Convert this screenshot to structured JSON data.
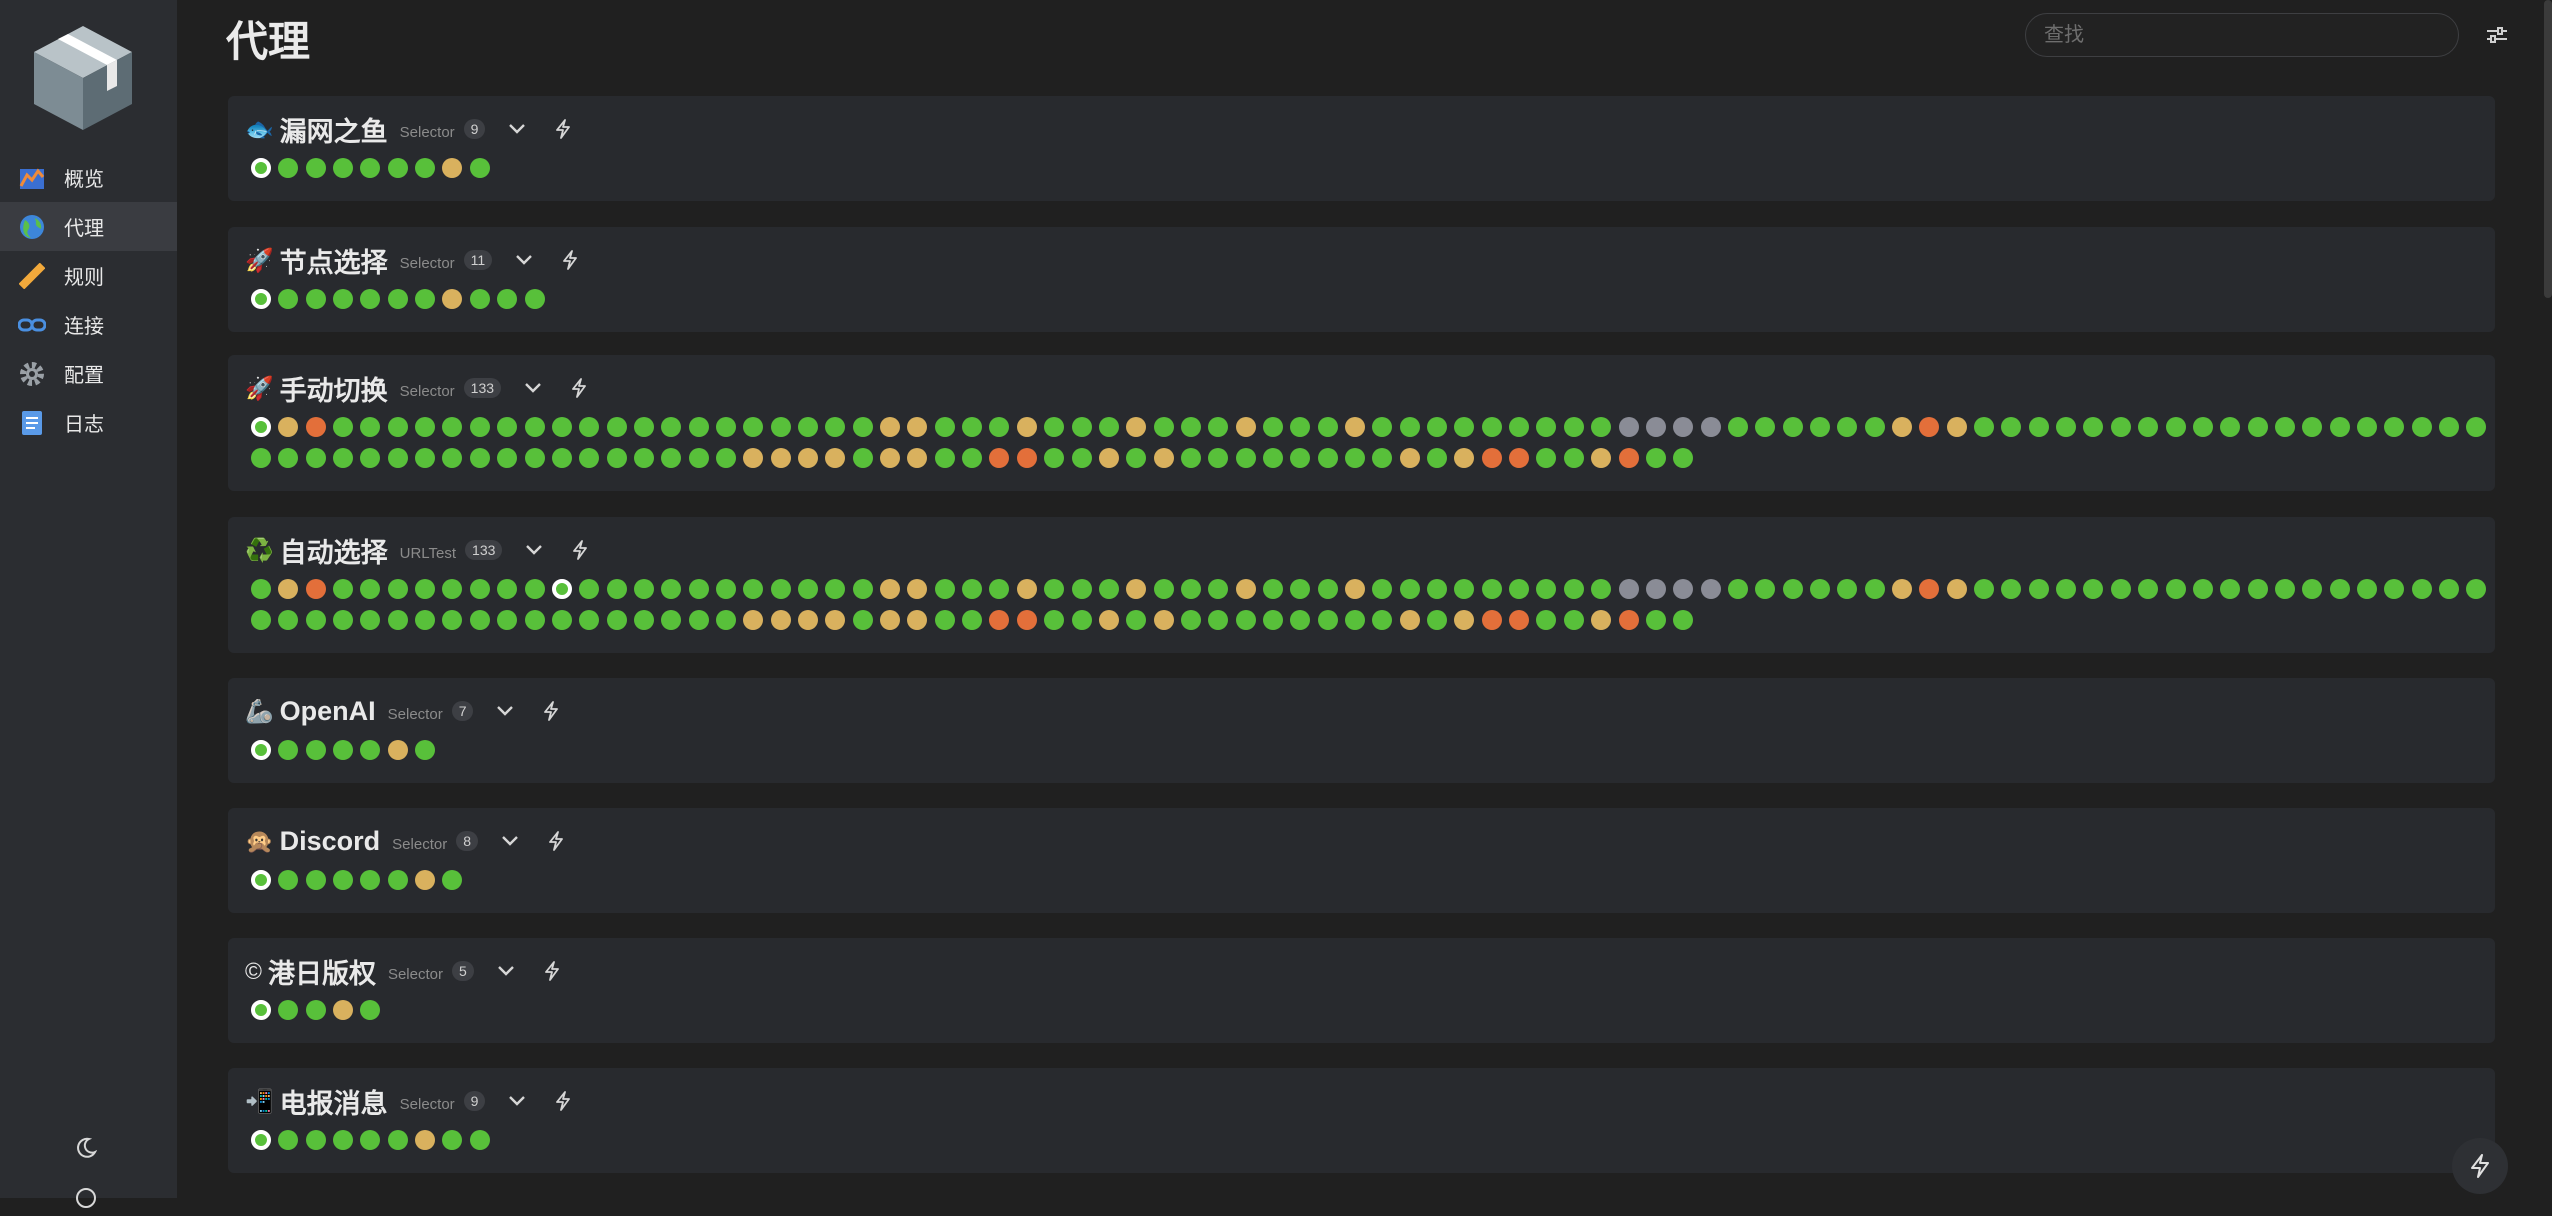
{
  "page": {
    "title": "代理"
  },
  "search": {
    "placeholder": "查找"
  },
  "colors": {
    "green": "#58c03a",
    "yellow": "#d9b15e",
    "orange": "#e36f3a",
    "gray": "#8a8c96",
    "card_bg": "#282a2e",
    "sidebar_bg": "#2b2d31"
  },
  "sidebar": {
    "items": [
      {
        "label": "概览",
        "icon": "chart-icon"
      },
      {
        "label": "代理",
        "icon": "globe-icon",
        "active": true
      },
      {
        "label": "规则",
        "icon": "ruler-icon"
      },
      {
        "label": "连接",
        "icon": "link-icon"
      },
      {
        "label": "配置",
        "icon": "gear-icon"
      },
      {
        "label": "日志",
        "icon": "document-icon"
      }
    ],
    "bottom_icons": [
      "moon-icon",
      "info-icon"
    ]
  },
  "groups": [
    {
      "emoji": "🐟",
      "name": "漏网之鱼",
      "type": "Selector",
      "count": "9",
      "selected": 0,
      "nodes": "GGGGGGGYG"
    },
    {
      "emoji": "🚀",
      "name": "节点选择",
      "type": "Selector",
      "count": "11",
      "selected": 0,
      "nodes": "GGGGGGGYGGG"
    },
    {
      "emoji": "🚀",
      "name": "手动切换",
      "type": "Selector",
      "count": "133",
      "selected": 0,
      "nodes": "GYOGGGGGGGGGGGGGGGGGGGGYYGGGYGGGYGGGYGGGYGGGGGGGGGRRRRGGGGGGYOYGGGGGGGGGGGGGGGGGGGGGGGGGGGGGGGGGGGGGYYYYGYYGGOOGGYGYGGGGGGGGYGYOOGGYOGG"
    },
    {
      "emoji": "♻️",
      "name": "自动选择",
      "type": "URLTest",
      "count": "133",
      "selected": 11,
      "nodes": "GYOGGGGGGGGGGGGGGGGGGGGYYGGGYGGGYGGGYGGGYGGGGGGGGGRRRRGGGGGGYOYGGGGGGGGGGGGGGGGGGGGGGGGGGGGGGGGGGGGGYYYYGYYGGOOGGYGYGGGGGGGGYGYOOGGYOGG"
    },
    {
      "emoji": "🦾",
      "name": "OpenAI",
      "type": "Selector",
      "count": "7",
      "selected": 0,
      "nodes": "GGGGGYG"
    },
    {
      "emoji": "🙊",
      "name": "Discord",
      "type": "Selector",
      "count": "8",
      "selected": 0,
      "nodes": "GGGGGGYG"
    },
    {
      "emoji": "©",
      "name": "港日版权",
      "type": "Selector",
      "count": "5",
      "selected": 0,
      "nodes": "GGGYG"
    },
    {
      "emoji": "📲",
      "name": "电报消息",
      "type": "Selector",
      "count": "9",
      "selected": 0,
      "nodes": "GGGGGGYGG"
    }
  ]
}
